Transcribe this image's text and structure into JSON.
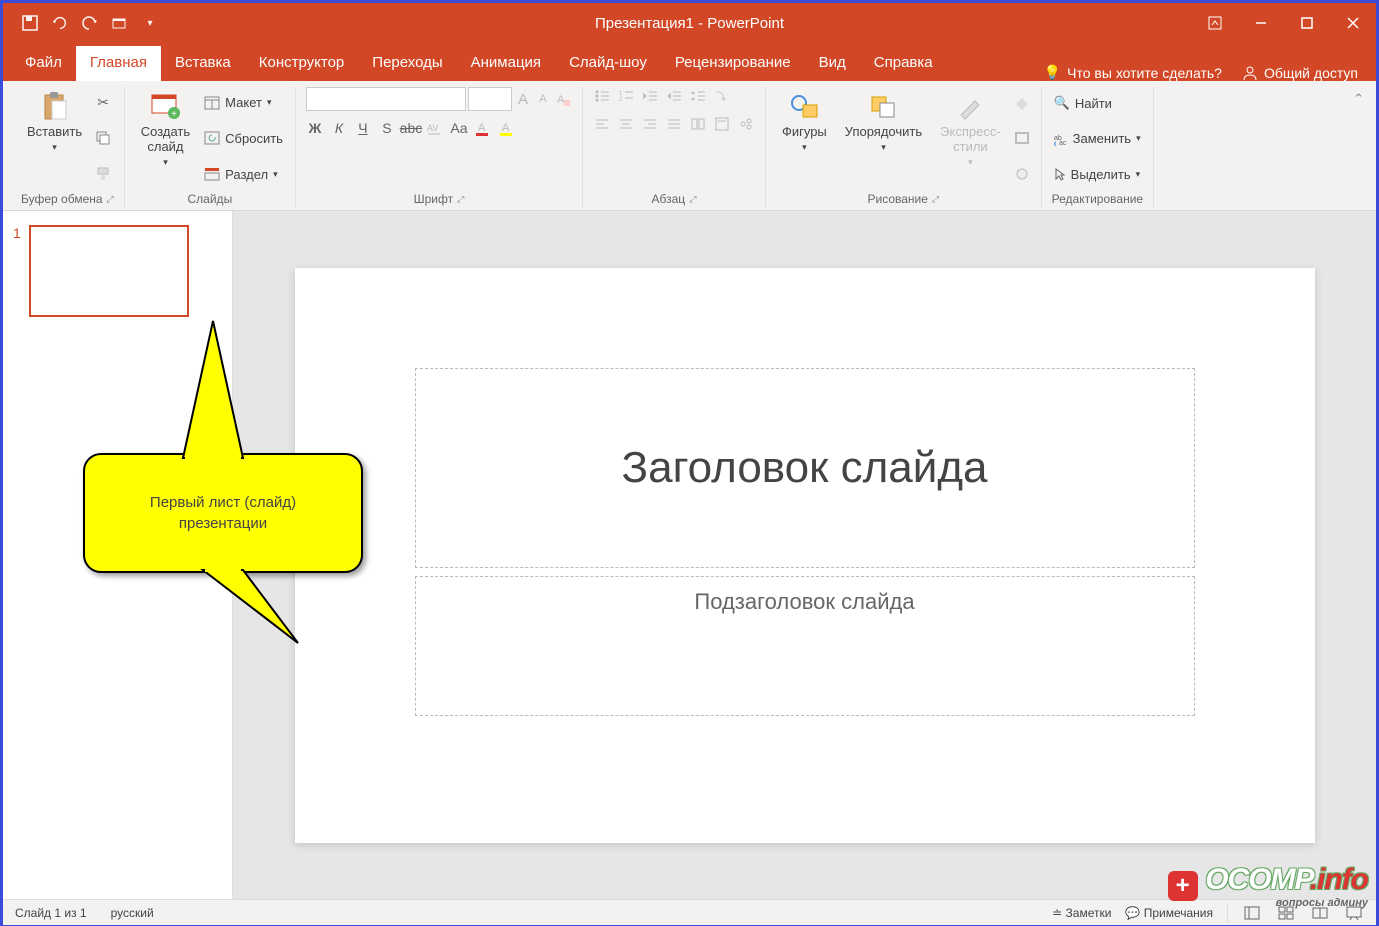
{
  "title": {
    "doc": "Презентация1",
    "sep": " - ",
    "app": "PowerPoint"
  },
  "tabs": {
    "file": "Файл",
    "home": "Главная",
    "insert": "Вставка",
    "design": "Конструктор",
    "transitions": "Переходы",
    "animation": "Анимация",
    "slideshow": "Слайд-шоу",
    "review": "Рецензирование",
    "view": "Вид",
    "help": "Справка",
    "tellme": "Что вы хотите сделать?",
    "share": "Общий доступ"
  },
  "ribbon": {
    "clipboard": {
      "paste": "Вставить",
      "label": "Буфер обмена"
    },
    "slides": {
      "new": "Создать\nслайд",
      "layout": "Макет",
      "reset": "Сбросить",
      "section": "Раздел",
      "label": "Слайды"
    },
    "font": {
      "label": "Шрифт"
    },
    "paragraph": {
      "label": "Абзац"
    },
    "drawing": {
      "shapes": "Фигуры",
      "arrange": "Упорядочить",
      "styles": "Экспресс-\nстили",
      "label": "Рисование"
    },
    "editing": {
      "find": "Найти",
      "replace": "Заменить",
      "select": "Выделить",
      "label": "Редактирование"
    }
  },
  "slide": {
    "number": "1",
    "title_ph": "Заголовок слайда",
    "subtitle_ph": "Подзаголовок слайда"
  },
  "callout": "Первый лист (слайд)\nпрезентации",
  "status": {
    "slide": "Слайд 1 из 1",
    "lang": "русский",
    "notes": "Заметки",
    "comments": "Примечания"
  },
  "watermark": {
    "brand": "OCOMP",
    "tld": ".info",
    "sub": "вопросы админу"
  }
}
